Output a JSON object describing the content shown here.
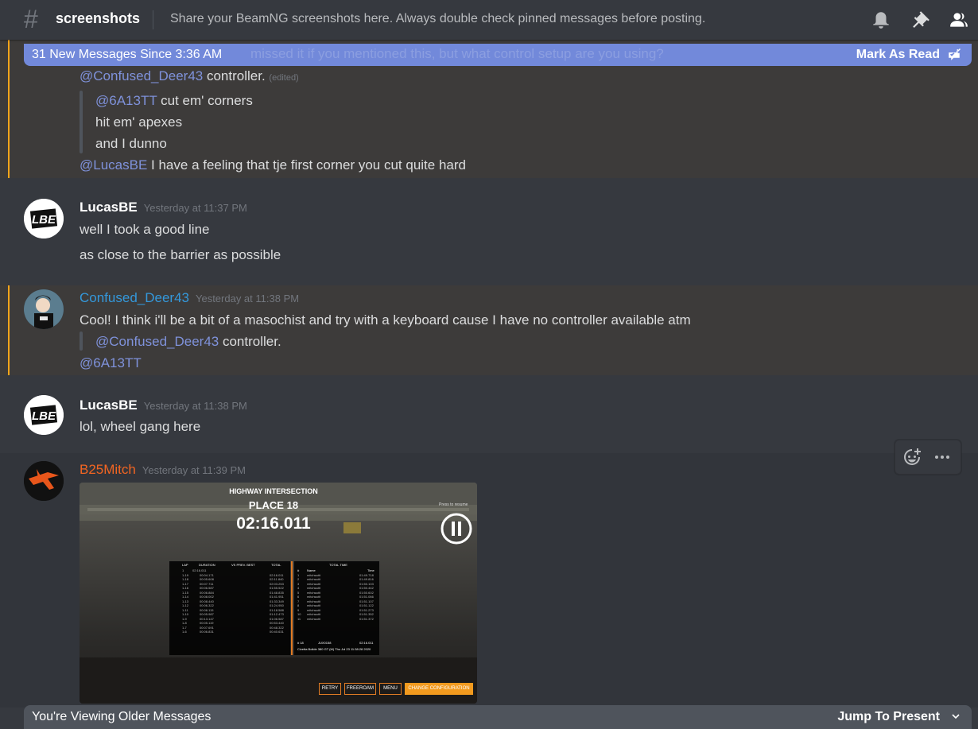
{
  "header": {
    "channel_name": "screenshots",
    "topic": "Share your BeamNG screenshots here. Always double check pinned messages before posting.",
    "icons": [
      "bell-icon",
      "pin-icon",
      "member-list-icon"
    ]
  },
  "new_messages_bar": {
    "text": "31 New Messages Since 3:36 AM",
    "ghost_text": "missed it if you mentioned this, but what control setup are you using?",
    "mark_read": "Mark As Read",
    "icon": "mark-read-icon"
  },
  "messages": [
    {
      "continued": true,
      "lines": [
        {
          "mention": "@Confused_Deer43",
          "text": " controller.",
          "edited": "(edited)"
        },
        {
          "quote": true,
          "mention": "@6A13TT",
          "text": " cut em' corners"
        },
        {
          "quote": true,
          "text": "hit em' apexes"
        },
        {
          "quote": true,
          "text": "and I dunno"
        },
        {
          "mention": "@LucasBE",
          "text": " I have a feeling that tje first corner you cut quite hard"
        }
      ]
    },
    {
      "author": "LucasBE",
      "timestamp": "Yesterday at 11:37 PM",
      "avatar_text": "LBE",
      "lines": [
        "well I took a good line",
        "as close to the barrier as possible"
      ]
    },
    {
      "author": "Confused_Deer43",
      "author_color": "#3498db",
      "timestamp": "Yesterday at 11:38 PM",
      "lines": [
        {
          "text": "Cool! I think i'll be a bit of a masochist and try with a keyboard cause I have no controller available atm"
        },
        {
          "quote": true,
          "mention": "@Confused_Deer43",
          "text": " controller."
        },
        {
          "mention": "@6A13TT",
          "text": ""
        }
      ]
    },
    {
      "author": "LucasBE",
      "timestamp": "Yesterday at 11:38 PM",
      "avatar_text": "LBE",
      "lines": [
        "lol, wheel gang here"
      ]
    },
    {
      "author": "B25Mitch",
      "author_color": "#f26522",
      "timestamp": "Yesterday at 11:39 PM",
      "attachment": {
        "title": "HIGHWAY INTERSECTION",
        "place": "PLACE 18",
        "time": "02:16.011",
        "press_hint": "Press  to resume",
        "left_table": {
          "headers": [
            "LAP",
            "DURATION",
            "VS PREV. BEST",
            "TOTAL"
          ],
          "rows": [
            [
              "1",
              "02:16.011",
              "",
              ""
            ],
            [
              "1-19",
              "00:04.171",
              "",
              "02:16.011"
            ],
            [
              "1-18",
              "00:05.608",
              "",
              "02:11.840"
            ],
            [
              "1-17",
              "00:07.711",
              "",
              "02:03.253"
            ],
            [
              "1-16",
              "00:06.587",
              "",
              "01:55.522"
            ],
            [
              "1-15",
              "00:06.884",
              "",
              "01:48.835"
            ],
            [
              "1-14",
              "00:08.002",
              "",
              "01:41.951"
            ],
            [
              "1-13",
              "00:08.440",
              "",
              "01:33.349"
            ],
            [
              "1-12",
              "00:06.322",
              "",
              "01:24.950"
            ],
            [
              "1-11",
              "00:06.115",
              "",
              "01:18.588"
            ],
            [
              "1-10",
              "00:05.987",
              "",
              "01:12.473"
            ],
            [
              "1-9",
              "00:13.147",
              "",
              "01:06.587"
            ],
            [
              "1-8",
              "00:05.119",
              "",
              "00:53.440"
            ],
            [
              "1-7",
              "00:07.691",
              "",
              "00:48.322"
            ],
            [
              "1-6",
              "00:06.831",
              "",
              "00:40.631"
            ]
          ]
        },
        "right_table": {
          "header": "TOTAL TIME",
          "col_headers": [
            "#",
            "Name",
            "Time"
          ],
          "rows": [
            [
              "1",
              "mitchsaitt",
              "01:49.718"
            ],
            [
              "2",
              "mitchsaitt",
              "01:49.816"
            ],
            [
              "3",
              "mitchsaitt",
              "01:50.103"
            ],
            [
              "4",
              "mitchsaitt",
              "01:50.442"
            ],
            [
              "5",
              "mitchsaitt",
              "01:50.602"
            ],
            [
              "6",
              "mitchsaitt",
              "01:51.066"
            ],
            [
              "7",
              "mitchsaitt",
              "01:51.107"
            ],
            [
              "8",
              "mitchsaitt",
              "01:51.122"
            ],
            [
              "9",
              "mitchsaitt",
              "01:51.273"
            ],
            [
              "10",
              "mitchsaitt",
              "01:51.352"
            ],
            [
              "11",
              "mitchsaitt",
              "01:51.372"
            ]
          ],
          "footer_place": "# 18",
          "footer_name": "JUX0158",
          "footer_time": "02:16.011",
          "footer_car": "Civetta Bolide 380 GT (M)  Thu Jul 23 11:38:28 2020"
        },
        "buttons": [
          "RETRY",
          "FREEROAM",
          "MENU",
          "CHANGE CONFIGURATION"
        ]
      }
    }
  ],
  "hover_toolbar": {
    "icons": [
      "add-reaction-icon",
      "more-options-icon"
    ]
  },
  "older_bar": {
    "text": "You're Viewing Older Messages",
    "jump": "Jump To Present"
  }
}
